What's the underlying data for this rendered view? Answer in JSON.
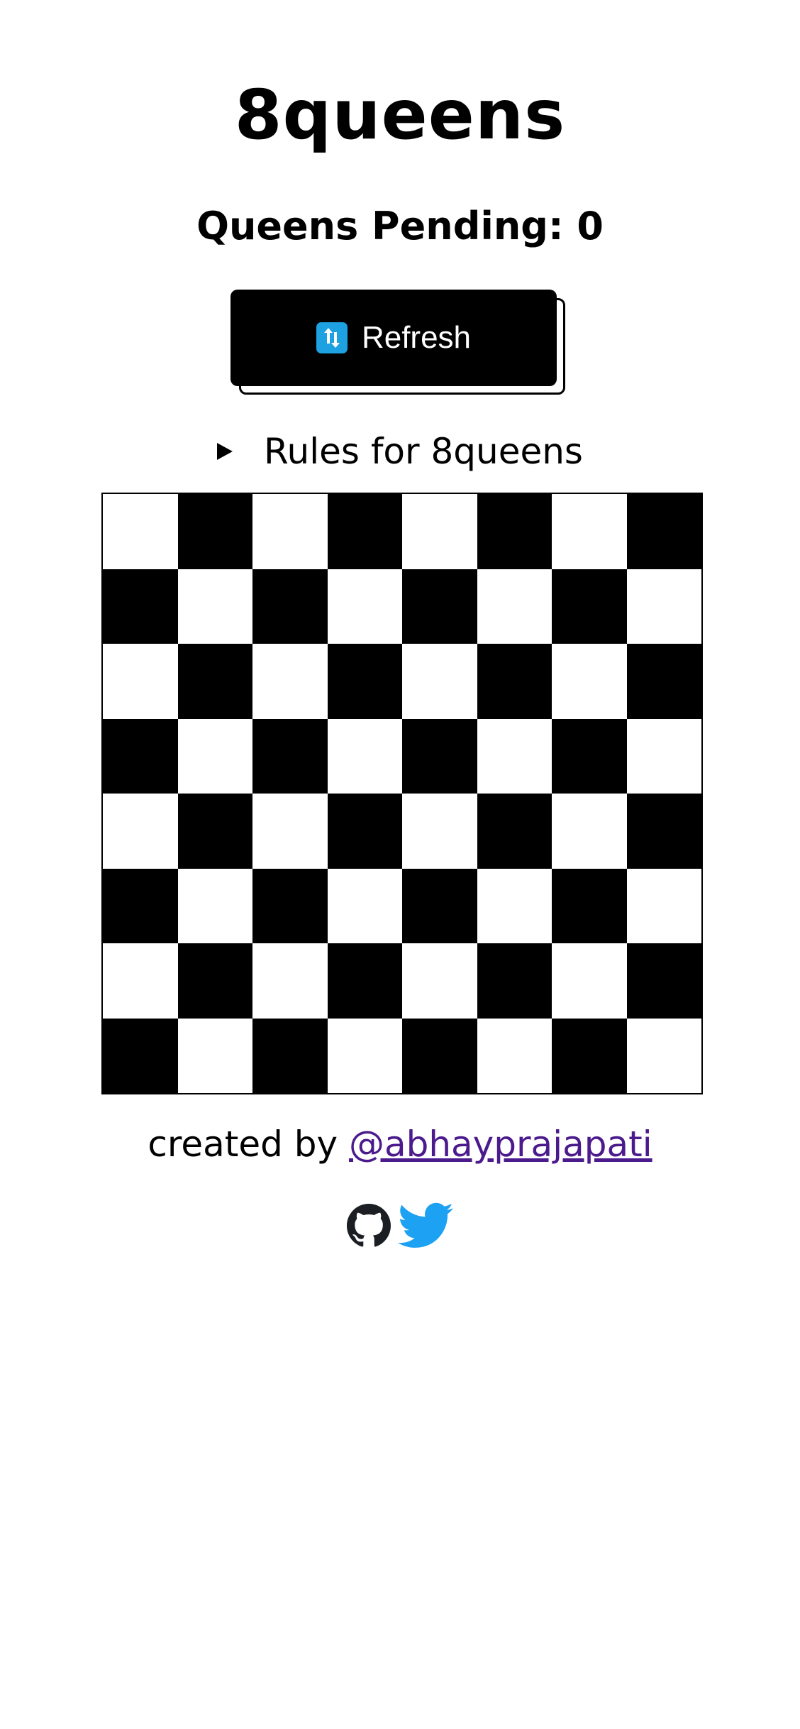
{
  "header": {
    "title": "8queens",
    "pending_label": "Queens Pending: 0"
  },
  "refresh": {
    "label": "Refresh",
    "icon": "refresh-icon",
    "icon_color": "#1da1e0"
  },
  "rules": {
    "label": "Rules for 8queens",
    "icon": "disclosure-triangle-icon"
  },
  "board": {
    "rows": 8,
    "cols": 8,
    "queens_placed": 0,
    "dark_color": "#000000",
    "light_color": "#ffffff"
  },
  "footer": {
    "created_by": "created by ",
    "author_link": "@abhayprajapati",
    "link_color": "#4b1a8c"
  },
  "socials": [
    {
      "name": "github-icon",
      "color": "#1b1f23"
    },
    {
      "name": "twitter-icon",
      "color": "#1da1f2"
    }
  ]
}
